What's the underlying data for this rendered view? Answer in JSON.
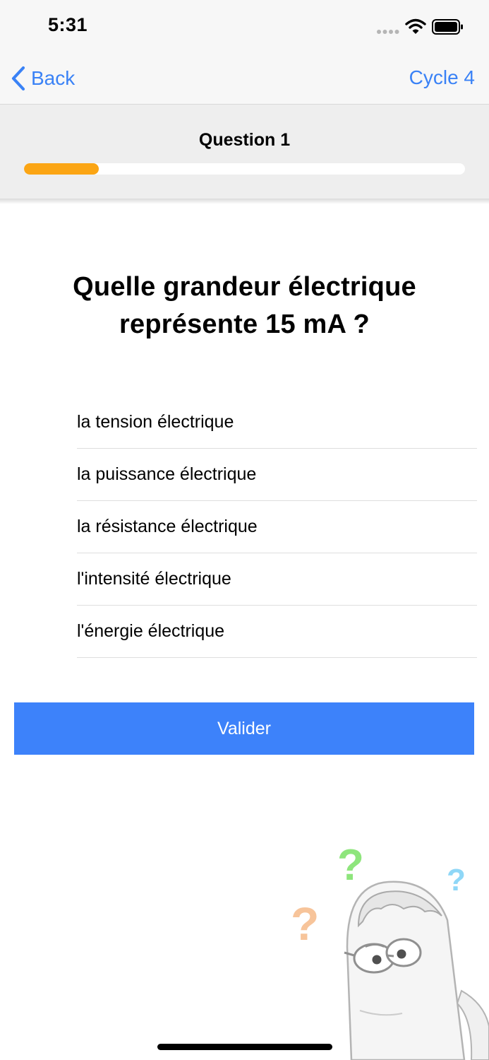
{
  "status_bar": {
    "time": "5:31",
    "signal_icon": "cellular-dots-icon",
    "wifi_icon": "wifi-icon",
    "battery_icon": "battery-icon"
  },
  "nav": {
    "back_label": "Back",
    "back_icon": "chevron-left-icon",
    "right_label": "Cycle 4",
    "accent_color": "#3a82f6"
  },
  "quiz": {
    "question_number_label": "Question 1",
    "progress_fraction": 0.17,
    "progress_color": "#fba514",
    "question_text": "Quelle grandeur électrique représente 15 mA ?",
    "answers": [
      "la tension électrique",
      "la puissance électrique",
      "la résistance électrique",
      "l'intensité électrique",
      "l'énergie électrique"
    ],
    "validate_label": "Valider",
    "validate_color": "#3d82fa"
  },
  "illustration": {
    "icon": "confused-mascot-icon"
  }
}
